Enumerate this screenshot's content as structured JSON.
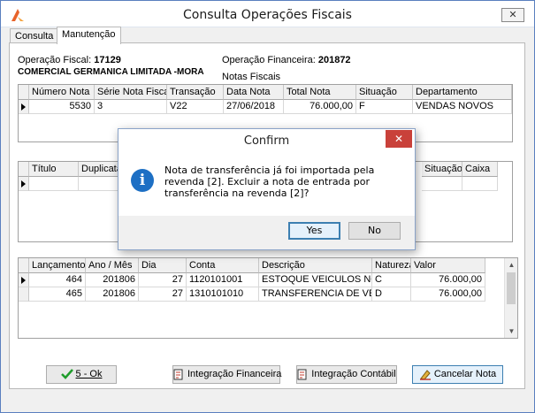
{
  "window": {
    "title": "Consulta Operações Fiscais",
    "close_glyph": "✕"
  },
  "tabs": [
    {
      "label": "Consulta"
    },
    {
      "label": "Manutenção"
    }
  ],
  "header": {
    "op_fiscal_label": "Operação Fiscal:",
    "op_fiscal_value": "17129",
    "op_financeira_label": "Operação Financeira:",
    "op_financeira_value": "201872",
    "company": "COMERCIAL GERMANICA LIMITADA -MORA",
    "notas_label": "Notas Fiscais"
  },
  "notas_grid": {
    "columns": [
      "Número Nota",
      "Série Nota Fiscal",
      "Transação",
      "Data Nota",
      "Total Nota",
      "Situação",
      "Departamento"
    ],
    "rows": [
      [
        "5530",
        "3",
        "V22",
        "27/06/2018",
        "76.000,00",
        "F",
        "VENDAS NOVOS"
      ]
    ]
  },
  "duplicatas_grid": {
    "columns": [
      "Título",
      "Duplicata",
      "Situação",
      "Caixa"
    ]
  },
  "lancamentos_grid": {
    "columns": [
      "Lançamento",
      "Ano / Mês",
      "Dia",
      "Conta",
      "Descrição",
      "Natureza",
      "Valor"
    ],
    "rows": [
      [
        "464",
        "201806",
        "27",
        "1120101001",
        "ESTOQUE VEICULOS NOVOS",
        "C",
        "76.000,00"
      ],
      [
        "465",
        "201806",
        "27",
        "1310101010",
        "TRANSFERENCIA DE VEICUL",
        "D",
        "76.000,00"
      ]
    ]
  },
  "buttons": {
    "ok": "5 - Ok",
    "integracao_financeira": "Integração Financeira",
    "integracao_contabil": "Integração Contábil",
    "cancelar_nota": "Cancelar Nota"
  },
  "dialog": {
    "title": "Confirm",
    "message": "Nota de transferência já foi importada pela revenda [2]. Excluir a nota de entrada por transferência na revenda [2]?",
    "yes": "Yes",
    "no": "No",
    "close_glyph": "✕",
    "icon_glyph": "i"
  },
  "colors": {
    "accent": "#3c7fb1",
    "dialog_close": "#c9413a",
    "info_icon": "#1d6fc4"
  }
}
